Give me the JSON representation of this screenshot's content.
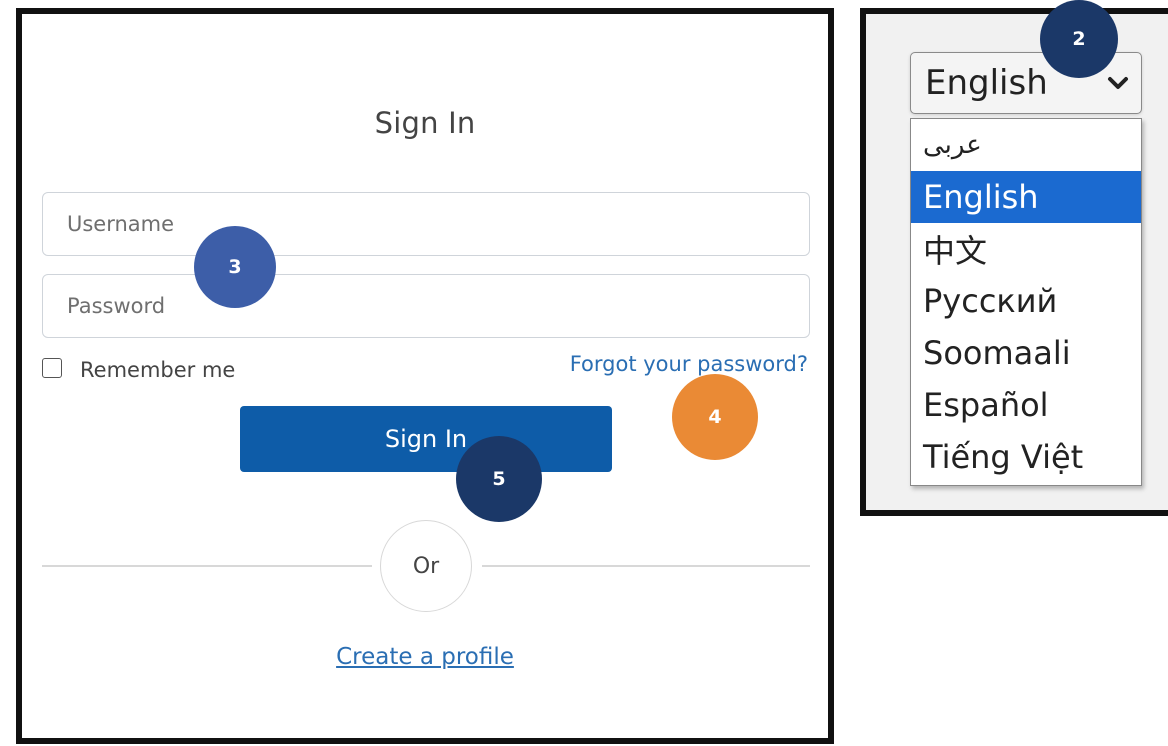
{
  "signin": {
    "title": "Sign In",
    "username_placeholder": "Username",
    "password_placeholder": "Password",
    "remember_label": "Remember me",
    "forgot_link": "Forgot your password?",
    "signin_button": "Sign In",
    "divider_text": "Or",
    "create_profile_link": "Create a profile"
  },
  "language": {
    "selected": "English",
    "options": [
      "عربى",
      "English",
      "中文",
      "Русский",
      "Soomaali",
      "Español",
      "Tiếng Việt"
    ]
  },
  "badges": {
    "b2": "2",
    "b3": "3",
    "b4": "4",
    "b5": "5"
  },
  "colors": {
    "primary_button": "#0e5ca8",
    "link": "#2a6eb3",
    "selected_option": "#1b6ad0",
    "badge_dark": "#1b3868",
    "badge_blue": "#3d5ea8",
    "badge_orange": "#ea8a35"
  }
}
